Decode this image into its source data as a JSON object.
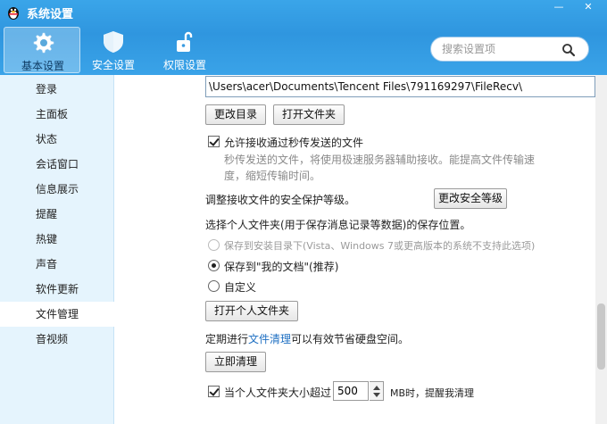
{
  "window": {
    "title": "系统设置",
    "minimize_glyph": "—",
    "close_glyph": "✕"
  },
  "categories": [
    {
      "label": "基本设置",
      "icon": "gear-icon",
      "selected": true
    },
    {
      "label": "安全设置",
      "icon": "shield-icon",
      "selected": false
    },
    {
      "label": "权限设置",
      "icon": "lock-icon",
      "selected": false
    }
  ],
  "search": {
    "placeholder": "搜索设置项"
  },
  "sidebar": {
    "items": [
      {
        "label": "登录"
      },
      {
        "label": "主面板"
      },
      {
        "label": "状态"
      },
      {
        "label": "会话窗口"
      },
      {
        "label": "信息展示"
      },
      {
        "label": "提醒"
      },
      {
        "label": "热键"
      },
      {
        "label": "声音"
      },
      {
        "label": "软件更新"
      },
      {
        "label": "文件管理",
        "active": true
      },
      {
        "label": "音视频"
      }
    ]
  },
  "content": {
    "path_value": "\\Users\\acer\\Documents\\Tencent Files\\791169297\\FileRecv\\",
    "change_dir_button": "更改目录",
    "open_folder_button": "打开文件夹",
    "allow_flash_transfer": {
      "label": "允许接收通过秒传发送的文件",
      "checked": true
    },
    "flash_hint_line1": "秒传发送的文件，将使用极速服务器辅助接收。能提高文件传输速",
    "flash_hint_line2": "度，缩短传输时间。",
    "security_level_label": "调整接收文件的安全保护等级。",
    "change_security_button": "更改安全等级",
    "personal_folder_label": "选择个人文件夹(用于保存消息记录等数据)的保存位置。",
    "options": [
      {
        "label": "保存到安装目录下(Vista、Windows 7或更高版本的系统不支持此选项)",
        "selected": false,
        "disabled": true
      },
      {
        "label": "保存到\"我的文档\"(推荐)",
        "selected": true,
        "disabled": false
      },
      {
        "label": "自定义",
        "selected": false,
        "disabled": false
      }
    ],
    "open_personal_folder_button": "打开个人文件夹",
    "cleanup_prefix": "定期进行",
    "cleanup_link": "文件清理",
    "cleanup_suffix": "可以有效节省硬盘空间。",
    "cleanup_now_button": "立即清理",
    "size_alert": {
      "prefix": "当个人文件夹大小超过",
      "value": "500",
      "suffix": "MB时，提醒我清理",
      "checked": true
    }
  },
  "colors": {
    "header": "#2f96df",
    "sidebar_bg": "#e5f4fd",
    "link": "#1e6fc2"
  }
}
